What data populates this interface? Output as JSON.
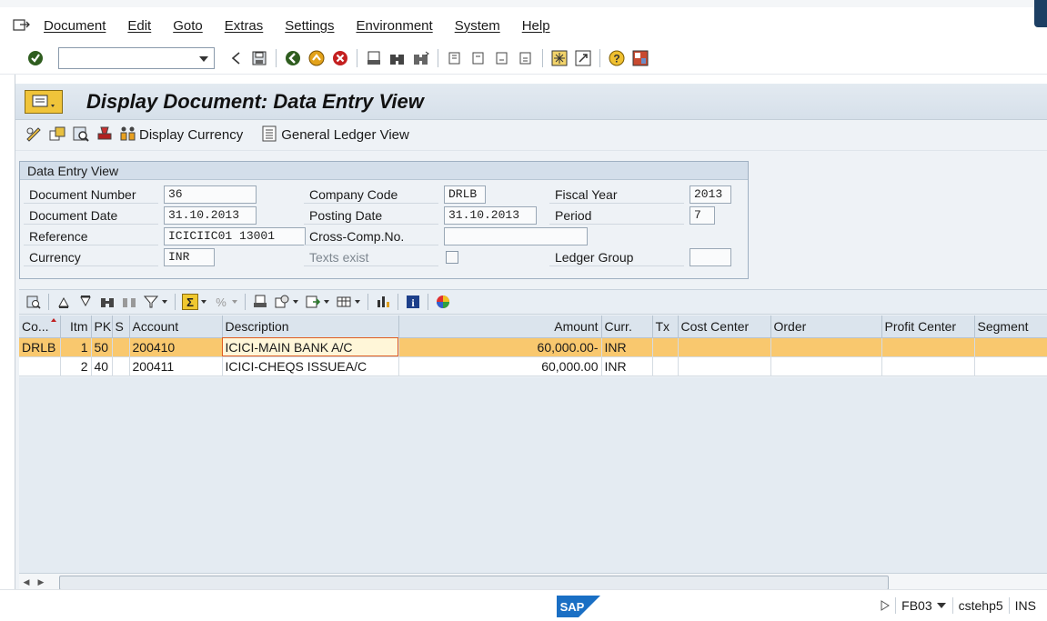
{
  "menu": [
    "Document",
    "Edit",
    "Goto",
    "Extras",
    "Settings",
    "Environment",
    "System",
    "Help"
  ],
  "command_field": {
    "value": ""
  },
  "page_title": "Display Document: Data Entry View",
  "app_toolbar": {
    "display_currency_label": "Display Currency",
    "gl_view_label": "General Ledger View"
  },
  "header": {
    "group_title": "Data Entry View",
    "doc_number_label": "Document Number",
    "doc_number": "36",
    "company_code_label": "Company Code",
    "company_code": "DRLB",
    "fiscal_year_label": "Fiscal Year",
    "fiscal_year": "2013",
    "doc_date_label": "Document Date",
    "doc_date": "31.10.2013",
    "posting_date_label": "Posting Date",
    "posting_date": "31.10.2013",
    "period_label": "Period",
    "period": "7",
    "reference_label": "Reference",
    "reference": "ICICIIC01 13001",
    "cross_comp_label": "Cross-Comp.No.",
    "cross_comp": "",
    "currency_label": "Currency",
    "currency": "INR",
    "texts_exist_label": "Texts exist",
    "texts_exist_checked": false,
    "ledger_group_label": "Ledger Group",
    "ledger_group": ""
  },
  "grid": {
    "columns": {
      "co": "Co...",
      "itm": "Itm",
      "pk": "PK",
      "s": "S",
      "account": "Account",
      "description": "Description",
      "amount": "Amount",
      "curr": "Curr.",
      "tx": "Tx",
      "cost_center": "Cost Center",
      "order": "Order",
      "profit_center": "Profit Center",
      "segment": "Segment"
    },
    "rows": [
      {
        "co": "DRLB",
        "itm": "1",
        "pk": "50",
        "s": "",
        "account": "200410",
        "description": "ICICI-MAIN BANK A/C",
        "amount": "60,000.00-",
        "curr": "INR",
        "tx": "",
        "cost_center": "",
        "order": "",
        "profit_center": "",
        "segment": ""
      },
      {
        "co": "",
        "itm": "2",
        "pk": "40",
        "s": "",
        "account": "200411",
        "description": "ICICI-CHEQS ISSUEA/C",
        "amount": "60,000.00",
        "curr": "INR",
        "tx": "",
        "cost_center": "",
        "order": "",
        "profit_center": "",
        "segment": ""
      }
    ]
  },
  "status": {
    "transaction": "FB03",
    "server": "cstehp5",
    "mode": "INS"
  },
  "colors": {
    "selected_row": "#f9c86e",
    "title_gradient": "#d6e0ea",
    "work_bg": "#eef2f6"
  }
}
